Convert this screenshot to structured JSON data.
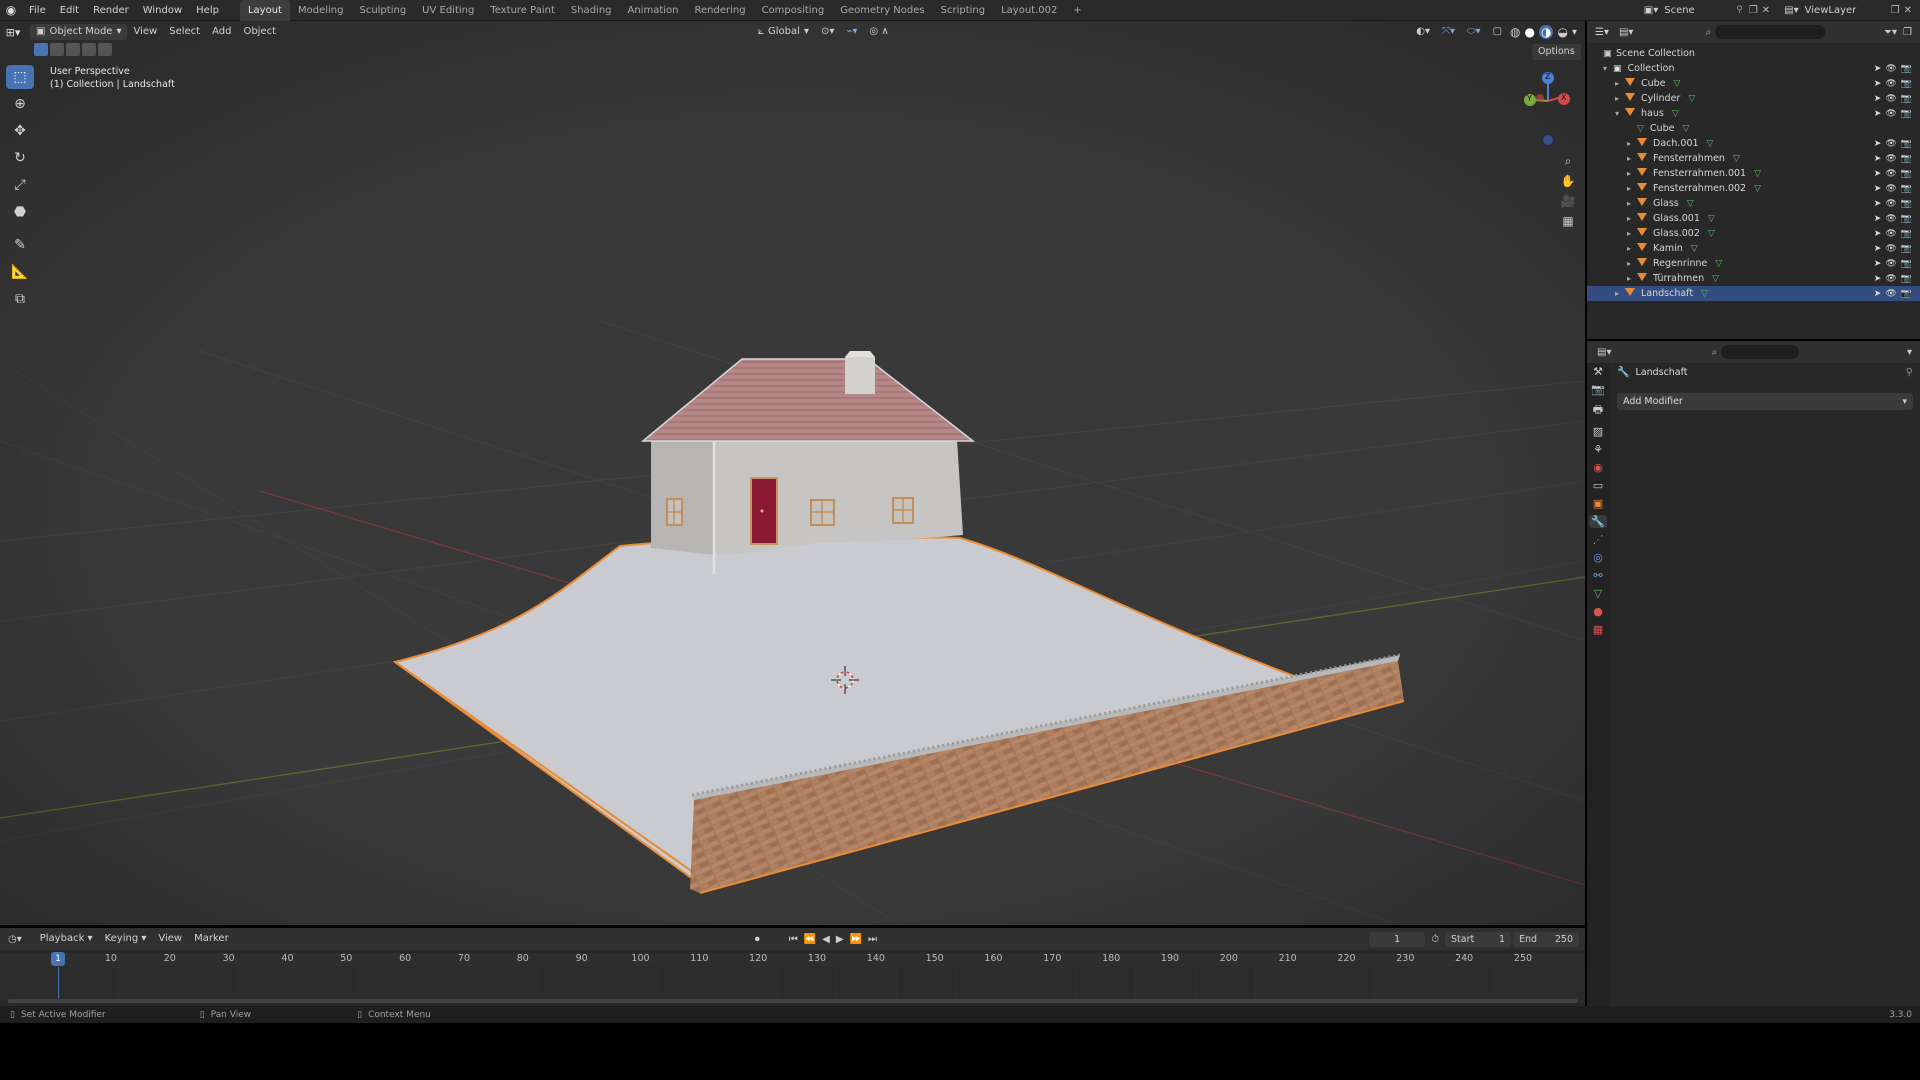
{
  "topbar": {
    "menus": [
      "File",
      "Edit",
      "Render",
      "Window",
      "Help"
    ],
    "workspaces": [
      "Layout",
      "Modeling",
      "Sculpting",
      "UV Editing",
      "Texture Paint",
      "Shading",
      "Animation",
      "Rendering",
      "Compositing",
      "Geometry Nodes",
      "Scripting",
      "Layout.002"
    ],
    "active_workspace": "Layout",
    "add_tab": "+",
    "scene": "Scene",
    "view_layer": "ViewLayer"
  },
  "viewport_header": {
    "mode": "Object Mode",
    "menus": [
      "View",
      "Select",
      "Add",
      "Object"
    ],
    "orientation": "Global",
    "options": "Options"
  },
  "viewport": {
    "perspective": "User Perspective",
    "collection_info": "(1) Collection | Landschaft",
    "gizmo": {
      "z": "Z",
      "y": "Y",
      "x": "X"
    }
  },
  "outliner": {
    "root": "Scene Collection",
    "items": [
      {
        "label": "Collection",
        "depth": 0,
        "type": "collection"
      },
      {
        "label": "Cube",
        "depth": 1,
        "type": "object"
      },
      {
        "label": "Cylinder",
        "depth": 1,
        "type": "object"
      },
      {
        "label": "haus",
        "depth": 1,
        "type": "object"
      },
      {
        "label": "Cube",
        "depth": 2,
        "type": "mesh"
      },
      {
        "label": "Dach.001",
        "depth": 2,
        "type": "object"
      },
      {
        "label": "Fensterrahmen",
        "depth": 2,
        "type": "object"
      },
      {
        "label": "Fensterrahmen.001",
        "depth": 2,
        "type": "object"
      },
      {
        "label": "Fensterrahmen.002",
        "depth": 2,
        "type": "object"
      },
      {
        "label": "Glass",
        "depth": 2,
        "type": "object"
      },
      {
        "label": "Glass.001",
        "depth": 2,
        "type": "object"
      },
      {
        "label": "Glass.002",
        "depth": 2,
        "type": "object"
      },
      {
        "label": "Kamin",
        "depth": 2,
        "type": "object"
      },
      {
        "label": "Regenrinne",
        "depth": 2,
        "type": "object"
      },
      {
        "label": "Türrahmen",
        "depth": 2,
        "type": "object"
      },
      {
        "label": "Landschaft",
        "depth": 1,
        "type": "object",
        "selected": true
      }
    ]
  },
  "properties": {
    "object_name": "Landschaft",
    "add_modifier": "Add Modifier"
  },
  "timeline": {
    "menus": [
      "Playback",
      "Keying",
      "View",
      "Marker"
    ],
    "current_frame": "1",
    "start_label": "Start",
    "start": "1",
    "end_label": "End",
    "end": "250",
    "ticks": [
      "1",
      "10",
      "20",
      "30",
      "40",
      "50",
      "60",
      "70",
      "80",
      "90",
      "100",
      "110",
      "120",
      "130",
      "140",
      "150",
      "160",
      "170",
      "180",
      "190",
      "200",
      "210",
      "220",
      "230",
      "240",
      "250"
    ]
  },
  "statusbar": {
    "hint1": "Set Active Modifier",
    "hint2": "Pan View",
    "hint3": "Context Menu",
    "version": "3.3.0"
  },
  "colors": {
    "accent": "#4772b3",
    "selection_orange": "#e98c36",
    "viewport_bg": "#3a3a3a"
  }
}
